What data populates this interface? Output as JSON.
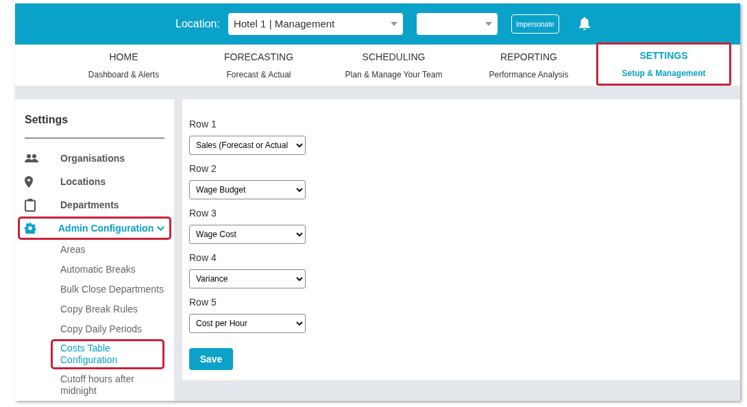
{
  "header": {
    "location_label": "Location:",
    "location_value": "Hotel 1 | Management",
    "impersonate_button": "Impersonate"
  },
  "nav_tabs": [
    {
      "title": "HOME",
      "subtitle": "Dashboard & Alerts",
      "selected": false,
      "highlighted": false
    },
    {
      "title": "FORECASTING",
      "subtitle": "Forecast & Actual",
      "selected": false,
      "highlighted": false
    },
    {
      "title": "SCHEDULING",
      "subtitle": "Plan & Manage Your Team",
      "selected": false,
      "highlighted": false
    },
    {
      "title": "REPORTING",
      "subtitle": "Performance Analysis",
      "selected": false,
      "highlighted": false
    },
    {
      "title": "SETTINGS",
      "subtitle": "Setup & Management",
      "selected": true,
      "highlighted": true
    }
  ],
  "sidebar": {
    "title": "Settings",
    "items": [
      {
        "label": "Organisations",
        "selected": false,
        "highlighted": false
      },
      {
        "label": "Locations",
        "selected": false,
        "highlighted": false
      },
      {
        "label": "Departments",
        "selected": false,
        "highlighted": false
      },
      {
        "label": "Admin Configuration",
        "selected": true,
        "highlighted": true,
        "expanded": true,
        "children": [
          {
            "label": "Areas",
            "selected": false,
            "highlighted": false
          },
          {
            "label": "Automatic Breaks",
            "selected": false,
            "highlighted": false
          },
          {
            "label": "Bulk Close Departments",
            "selected": false,
            "highlighted": false
          },
          {
            "label": "Copy Break Rules",
            "selected": false,
            "highlighted": false
          },
          {
            "label": "Copy Daily Periods",
            "selected": false,
            "highlighted": false
          },
          {
            "label": "Costs Table Configuration",
            "selected": true,
            "highlighted": true
          },
          {
            "label": "Cutoff hours after midnight",
            "selected": false,
            "highlighted": false
          }
        ]
      }
    ]
  },
  "form": {
    "rows": [
      {
        "label": "Row 1",
        "value": "Sales (Forecast or Actual"
      },
      {
        "label": "Row 2",
        "value": "Wage Budget"
      },
      {
        "label": "Row 3",
        "value": "Wage Cost"
      },
      {
        "label": "Row 4",
        "value": "Variance"
      },
      {
        "label": "Row 5",
        "value": "Cost per Hour"
      }
    ],
    "save_button": "Save"
  }
}
